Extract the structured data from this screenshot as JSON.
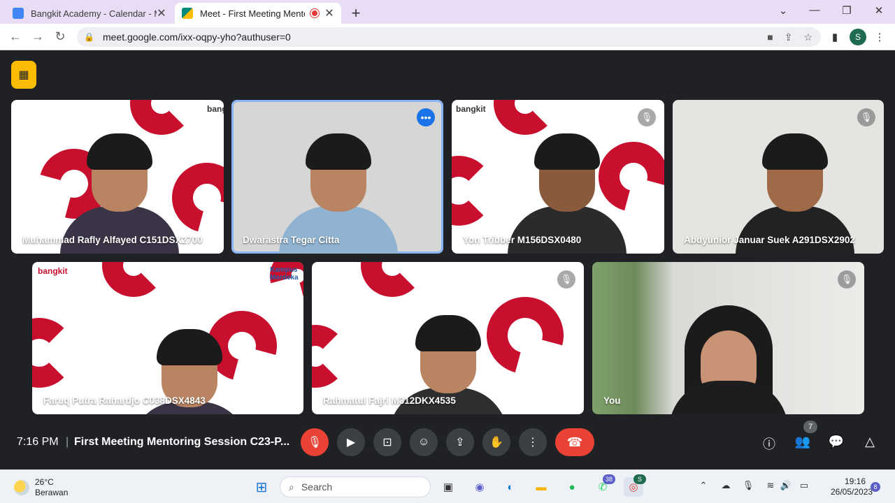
{
  "browser": {
    "tabs": [
      {
        "title": "Bangkit Academy - Calendar - M",
        "favicon_color": "#4285f4"
      },
      {
        "title": "Meet - First Meeting Mentor",
        "favicon_color": "#00897b",
        "recording": true
      }
    ],
    "new_tab_label": "+",
    "url": "meet.google.com/ixx-oqpy-yho?authuser=0",
    "profile_initial": "S"
  },
  "meet": {
    "participants": [
      {
        "name": "Muhammad Rafly Alfayed C151DSX2700",
        "muted": false
      },
      {
        "name": "Dwarastra Tegar Citta",
        "muted": false,
        "active": true
      },
      {
        "name": "Yon Tribber M156DSX0480",
        "muted": true
      },
      {
        "name": "Abdyunior Januar Suek A291DSX2902",
        "muted": true
      },
      {
        "name": "Faruq Putra Rahardjo C038DSX4843",
        "muted": false
      },
      {
        "name": "Rahmatul Fajri M312DKX4535",
        "muted": true
      },
      {
        "name": "You",
        "muted": true
      }
    ],
    "logos": {
      "bangkit": "bangkit",
      "kampus": "Kampus Merdeka"
    },
    "time": "7:16 PM",
    "separator": "|",
    "meeting_title": "First Meeting Mentoring Session C23-P...",
    "participant_count": "7",
    "colors": {
      "accent": "#1a73e8",
      "danger": "#ea4335",
      "bg": "#202124",
      "brand_red": "#c8102e"
    }
  },
  "taskbar": {
    "weather_temp": "26°C",
    "weather_desc": "Berawan",
    "search_placeholder": "Search",
    "teams_badge": "38",
    "chrome_badge": "S",
    "time": "19:16",
    "date": "26/05/2023",
    "notification_count": "8"
  }
}
